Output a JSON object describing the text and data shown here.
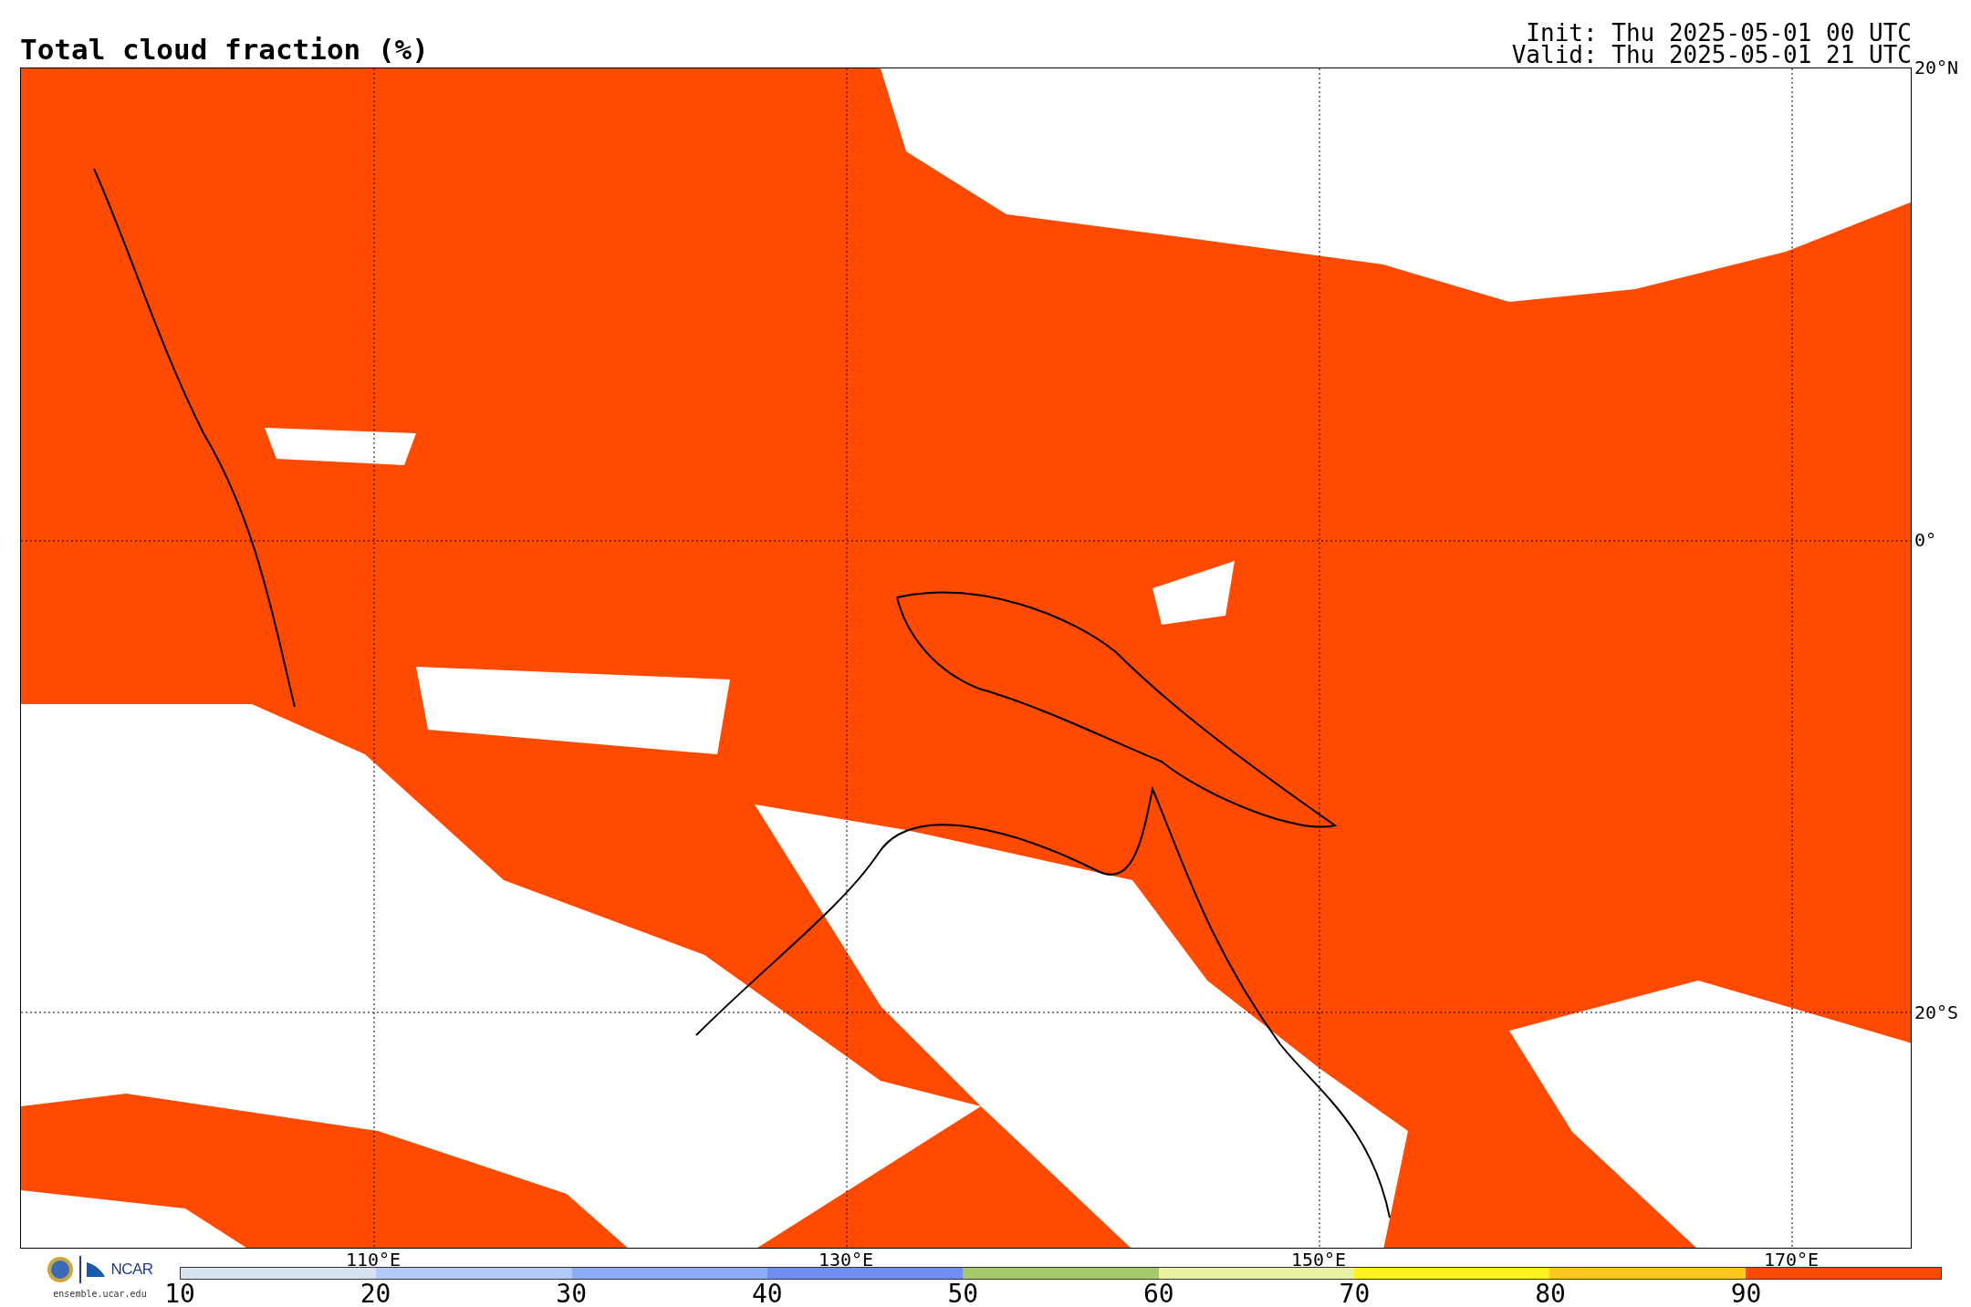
{
  "title": "Total cloud fraction (%)",
  "run_info": [
    "Init: Thu 2025-05-01 00 UTC",
    "Valid: Thu 2025-05-01 21 UTC"
  ],
  "map": {
    "latitude_labels": [
      "20°N",
      "0°",
      "20°S"
    ],
    "longitude_labels": [
      "110°E",
      "130°E",
      "150°E",
      "170°E"
    ]
  },
  "logo": {
    "org": "NCAR",
    "site": "ensemble.ucar.edu"
  },
  "colorbar": {
    "segments": [
      {
        "color": "#d8e2ee"
      },
      {
        "color": "#b3c9fa"
      },
      {
        "color": "#8eacf5"
      },
      {
        "color": "#6f8df2"
      },
      {
        "color": "#a3c96a"
      },
      {
        "color": "#e8f2a0"
      },
      {
        "color": "#fff41a"
      },
      {
        "color": "#ffc81e"
      },
      {
        "color": "#ff4a00"
      }
    ],
    "ticks": [
      "10",
      "20",
      "30",
      "40",
      "50",
      "60",
      "70",
      "80",
      "90"
    ]
  }
}
